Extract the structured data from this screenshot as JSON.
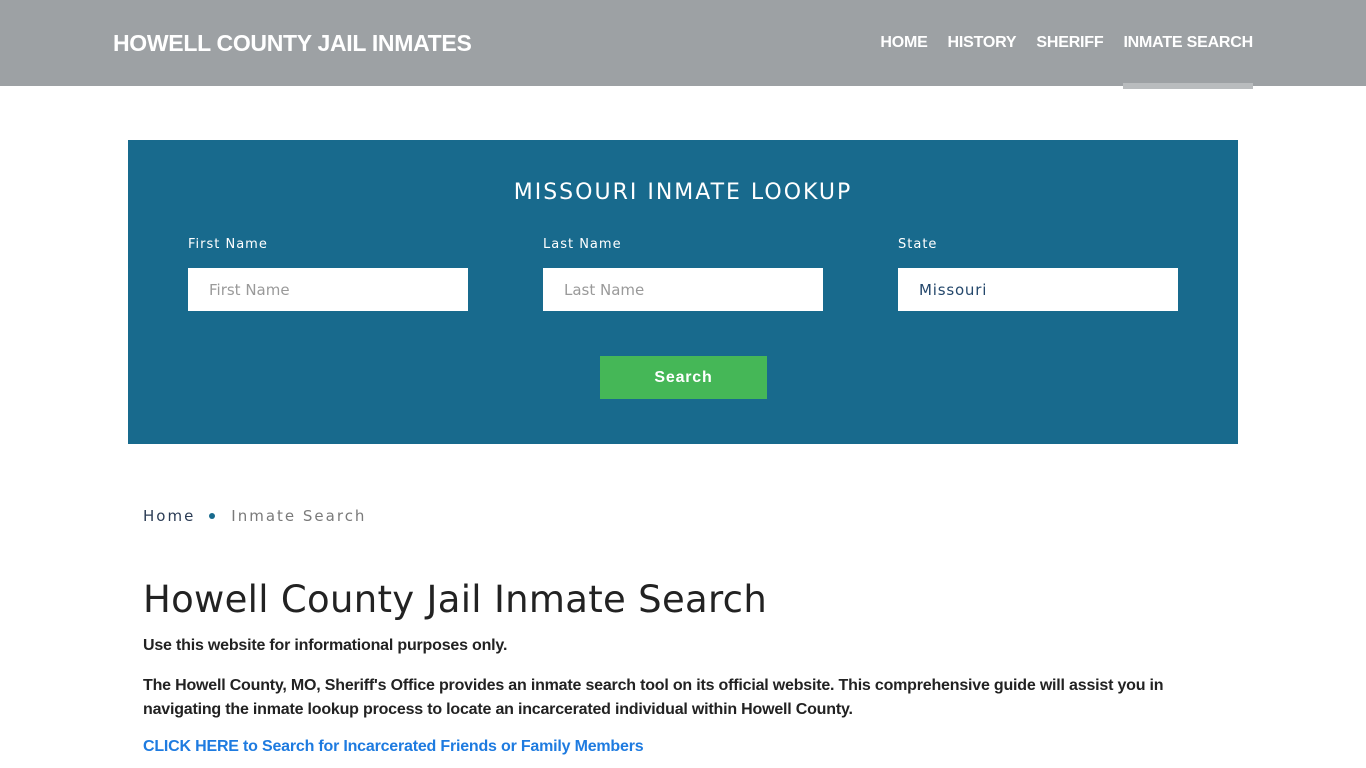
{
  "header": {
    "site_title": "HOWELL COUNTY JAIL INMATES",
    "nav": [
      {
        "label": "HOME",
        "active": false
      },
      {
        "label": "HISTORY",
        "active": false
      },
      {
        "label": "SHERIFF",
        "active": false
      },
      {
        "label": "INMATE SEARCH",
        "active": true
      }
    ]
  },
  "lookup": {
    "title": "MISSOURI INMATE LOOKUP",
    "first_name": {
      "label": "First Name",
      "placeholder": "First Name",
      "value": ""
    },
    "last_name": {
      "label": "Last Name",
      "placeholder": "Last Name",
      "value": ""
    },
    "state": {
      "label": "State",
      "value": "Missouri"
    },
    "search_label": "Search"
  },
  "breadcrumb": {
    "home": "Home",
    "current": "Inmate Search"
  },
  "content": {
    "title": "Howell County Jail Inmate Search",
    "disclaimer": "Use this website for informational purposes only.",
    "intro": "The Howell County, MO, Sheriff's Office provides an inmate search tool on its official website. This comprehensive guide will assist you in navigating the inmate lookup process to locate an incarcerated individual within Howell County.",
    "cta_link": "CLICK HERE to Search for Incarcerated Friends or Family Members"
  },
  "colors": {
    "header_bg": "#9da1a4",
    "lookup_bg": "#186a8d",
    "button_bg": "#45b757",
    "link": "#1e7be0"
  }
}
